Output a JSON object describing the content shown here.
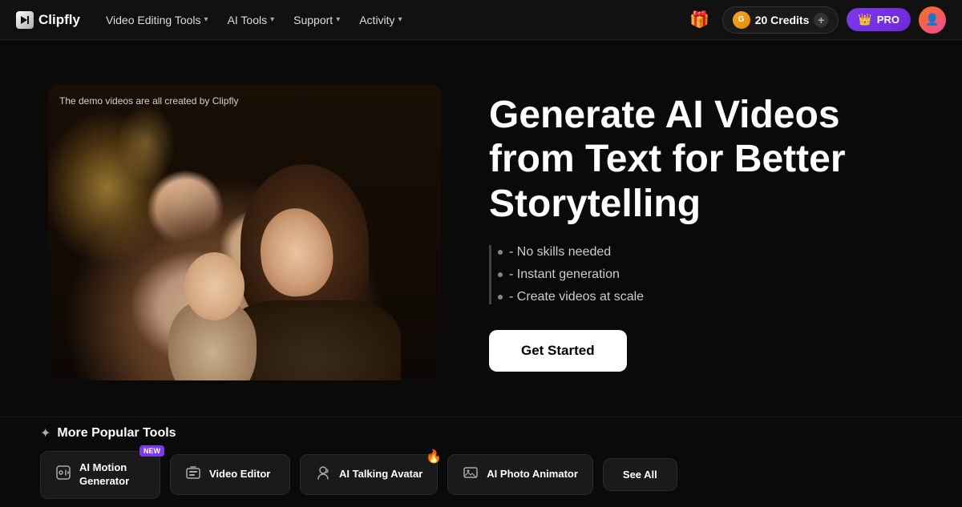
{
  "brand": {
    "name": "Clipfly",
    "logo_symbol": "✦"
  },
  "navbar": {
    "links": [
      {
        "label": "Video Editing Tools",
        "has_dropdown": true
      },
      {
        "label": "AI Tools",
        "has_dropdown": true
      },
      {
        "label": "Support",
        "has_dropdown": true
      },
      {
        "label": "Activity",
        "has_dropdown": true
      }
    ],
    "credits": {
      "amount": "20 Credits",
      "plus_symbol": "+"
    },
    "pro_label": "PRO",
    "gift_emoji": "🎁",
    "crown_emoji": "👑"
  },
  "hero": {
    "video_label": "The demo videos are all created by Clipfly",
    "title": "Generate AI Videos from Text for Better Storytelling",
    "features": [
      "- No skills needed",
      "- Instant generation",
      "- Create videos at scale"
    ],
    "cta_label": "Get Started"
  },
  "tools_section": {
    "title": "More Popular Tools",
    "sparkle": "✦",
    "tools": [
      {
        "label": "AI Motion Generator",
        "icon": "🤖",
        "badge": "NEW"
      },
      {
        "label": "Video Editor",
        "icon": "🎬",
        "badge": null
      },
      {
        "label": "AI Talking Avatar",
        "icon": "🎧",
        "badge": "🔥"
      },
      {
        "label": "AI Photo Animator",
        "icon": "🖼",
        "badge": null
      }
    ],
    "see_all_label": "See All"
  }
}
